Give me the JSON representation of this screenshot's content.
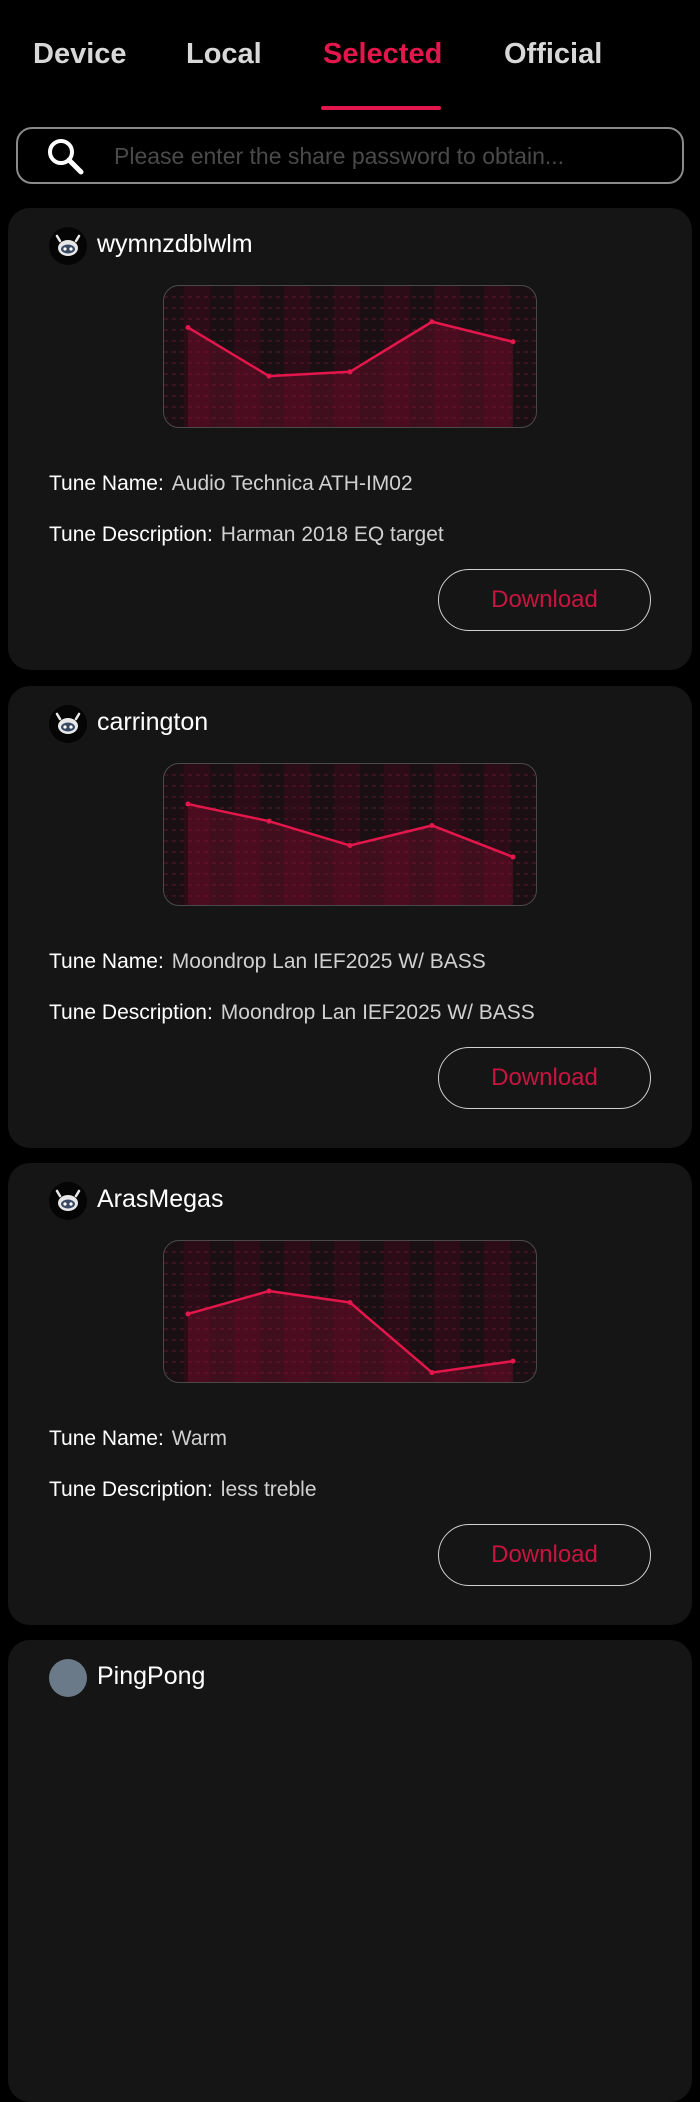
{
  "tabs": [
    {
      "label": "Device"
    },
    {
      "label": "Local"
    },
    {
      "label": "Selected",
      "active": true
    },
    {
      "label": "Official"
    }
  ],
  "search": {
    "placeholder": "Please enter the share password to obtain..."
  },
  "labels": {
    "tune_name": "Tune Name:",
    "tune_description": "Tune Description:",
    "download": "Download"
  },
  "colors": {
    "accent": "#e3174b",
    "card": "#151515",
    "background": "#000000"
  },
  "cards": [
    {
      "user": "wymnzdblwlm",
      "avatar_icon": "robot-mascot-icon",
      "tune_name": "Audio Technica ATH-IM02",
      "tune_description": "Harman 2018 EQ target",
      "eq_levels": [
        0.29,
        0.63,
        0.6,
        0.25,
        0.39
      ]
    },
    {
      "user": "carrington",
      "avatar_icon": "robot-mascot-icon",
      "tune_name": "Moondrop Lan IEF2025 W/ BASS",
      "tune_description": "Moondrop Lan IEF2025 W/ BASS",
      "eq_levels": [
        0.28,
        0.4,
        0.57,
        0.43,
        0.65
      ]
    },
    {
      "user": "ArasMegas",
      "avatar_icon": "robot-mascot-icon",
      "tune_name": "Warm",
      "tune_description": "less treble",
      "eq_levels": [
        0.51,
        0.35,
        0.43,
        0.92,
        0.84
      ]
    },
    {
      "user": "PingPong",
      "avatar_icon": "photo-avatar-icon",
      "tune_name": "",
      "tune_description": "",
      "eq_levels": []
    }
  ]
}
